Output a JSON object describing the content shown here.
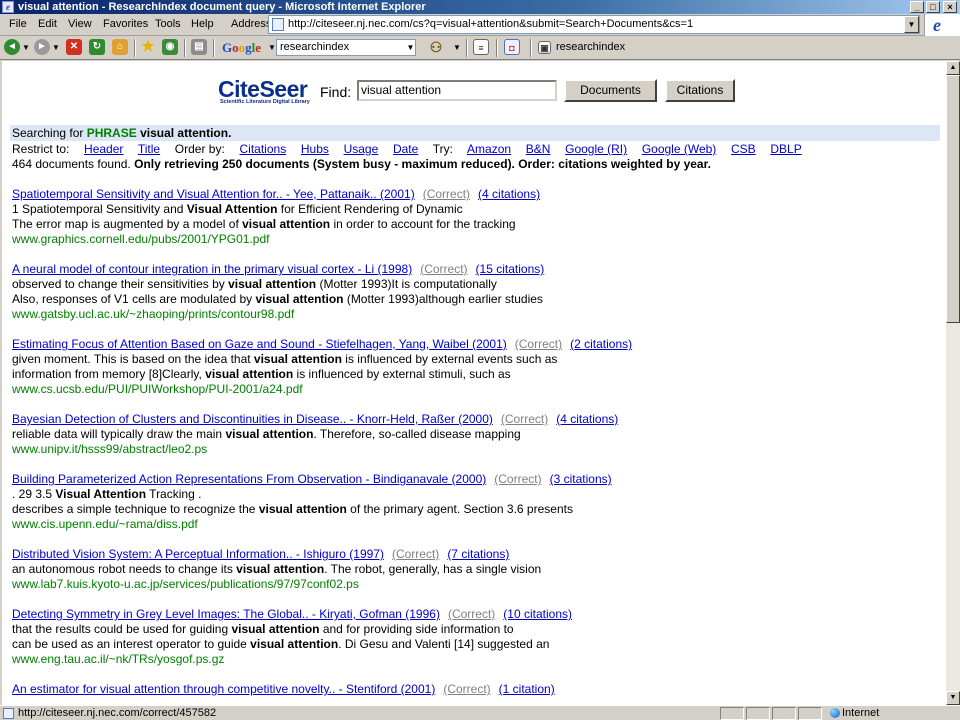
{
  "window": {
    "title": "visual attention - ResearchIndex document query - Microsoft Internet Explorer"
  },
  "menu": [
    "File",
    "Edit",
    "View",
    "Favorites",
    "Tools",
    "Help"
  ],
  "address": {
    "label": "Address",
    "url": "http://citeseer.nj.nec.com/cs?q=visual+attention&submit=Search+Documents&cs=1"
  },
  "toolbar": {
    "google_label": "Google",
    "google_query": "researchindex",
    "link_label": "researchindex"
  },
  "logo": {
    "name": "CiteSeer",
    "tagline": "Scientific Literature Digital Library"
  },
  "search": {
    "find_label": "Find:",
    "query": "visual attention",
    "documents_button": "Documents",
    "citations_button": "Citations"
  },
  "header": {
    "searching_prefix": "Searching for ",
    "phrase_label": "PHRASE",
    "phrase_term": "visual attention.",
    "restrict_label": "Restrict to:",
    "restrict_links": [
      "Header",
      "Title"
    ],
    "order_label": "Order by:",
    "order_links": [
      "Citations",
      "Hubs",
      "Usage",
      "Date"
    ],
    "try_label": "Try:",
    "try_links": [
      "Amazon",
      "B&N",
      "Google (RI)",
      "Google (Web)",
      "CSB",
      "DBLP"
    ],
    "found_text": "464 documents found.",
    "found_bold": "Only retrieving 250 documents (System busy - maximum reduced). Order: citations weighted by year."
  },
  "results": [
    {
      "title": "Spatiotemporal Sensitivity and Visual Attention for.. - Yee, Pattanaik.. (2001)",
      "correct": "(Correct)",
      "citations": "(4 citations)",
      "snippets": [
        [
          "1 Spatiotemporal Sensitivity and ",
          "Visual Attention",
          " for Efficient Rendering of Dynamic"
        ],
        [
          "The error map is augmented by a model of ",
          "visual attention",
          " in order to account for the tracking"
        ]
      ],
      "url": "www.graphics.cornell.edu/pubs/2001/YPG01.pdf"
    },
    {
      "title": "A neural model of contour integration in the primary visual cortex - Li (1998)",
      "correct": "(Correct)",
      "citations": "(15 citations)",
      "snippets": [
        [
          "observed to change their sensitivities by ",
          "visual attention",
          " (Motter 1993)It is computationally"
        ],
        [
          "Also, responses of V1 cells are modulated by ",
          "visual attention",
          " (Motter 1993)although earlier studies"
        ]
      ],
      "url": "www.gatsby.ucl.ac.uk/~zhaoping/prints/contour98.pdf"
    },
    {
      "title": "Estimating Focus of Attention Based on Gaze and Sound - Stiefelhagen, Yang, Waibel (2001)",
      "correct": "(Correct)",
      "citations": "(2 citations)",
      "snippets": [
        [
          "given moment. This is based on the idea that ",
          "visual attention",
          " is influenced by external events such as"
        ],
        [
          "information from memory [8]Clearly, ",
          "visual attention",
          " is influenced by external stimuli, such as"
        ]
      ],
      "url": "www.cs.ucsb.edu/PUI/PUIWorkshop/PUI-2001/a24.pdf"
    },
    {
      "title": "Bayesian Detection of Clusters and Discontinuities in Disease.. - Knorr-Held, Raßer (2000)",
      "correct": "(Correct)",
      "citations": "(4 citations)",
      "snippets": [
        [
          "reliable data will typically draw the main ",
          "visual attention",
          ". Therefore, so-called disease mapping"
        ]
      ],
      "url": "www.unipv.it/hsss99/abstract/leo2.ps"
    },
    {
      "title": "Building Parameterized Action Representations From Observation - Bindiganavale (2000)",
      "correct": "(Correct)",
      "citations": "(3 citations)",
      "snippets": [
        [
          ". 29 3.5 ",
          "Visual Attention",
          " Tracking ."
        ],
        [
          "describes a simple technique to recognize the ",
          "visual attention",
          " of the primary agent. Section 3.6 presents"
        ]
      ],
      "url": "www.cis.upenn.edu/~rama/diss.pdf"
    },
    {
      "title": "Distributed Vision System: A Perceptual Information.. - Ishiguro (1997)",
      "correct": "(Correct)",
      "citations": "(7 citations)",
      "snippets": [
        [
          "an autonomous robot needs to change its ",
          "visual attention",
          ". The robot, generally, has a single vision"
        ]
      ],
      "url": "www.lab7.kuis.kyoto-u.ac.jp/services/publications/97/97conf02.ps"
    },
    {
      "title": "Detecting Symmetry in Grey Level Images: The Global.. - Kiryati, Gofman (1996)",
      "correct": "(Correct)",
      "citations": "(10 citations)",
      "snippets": [
        [
          "that the results could be used for guiding ",
          "visual attention",
          " and for providing side information to"
        ],
        [
          "can be used as an interest operator to guide ",
          "visual attention",
          ". Di Gesu and Valenti [14] suggested an"
        ]
      ],
      "url": "www.eng.tau.ac.il/~nk/TRs/yosgof.ps.gz"
    },
    {
      "title": "An estimator for visual attention through competitive novelty.. - Stentiford (2001)",
      "correct": "(Correct)",
      "citations": "(1 citation)",
      "snippets": [],
      "url": ""
    }
  ],
  "status": {
    "text": "http://citeseer.nj.nec.com/correct/457582",
    "zone": "Internet"
  }
}
